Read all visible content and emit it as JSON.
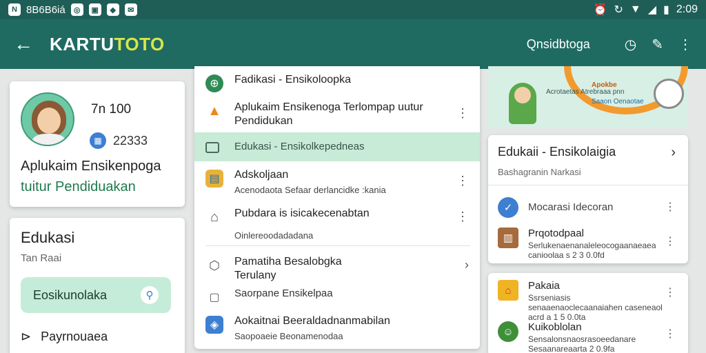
{
  "status": {
    "time": "2:09",
    "left_text": "8B6B6iá"
  },
  "appbar": {
    "title_a": "KARTU",
    "title_b": "TOTO",
    "subtitle": "Qnsidbtoga"
  },
  "profile": {
    "stat1": "7n 100",
    "stat2": "22333",
    "name_line1": "Aplukaim Ensikenpoga",
    "name_line2": "tuitur Pendiduakan"
  },
  "left_card": {
    "heading": "Edukasi",
    "subtext": "Tan Raai",
    "button_label": "Eosikunolaka",
    "pay_label": "Payrnouaea"
  },
  "middle_list": [
    {
      "title": "Fadikasi - Ensikoloopka",
      "desc": "",
      "icon": "green-circle-icon",
      "more": false
    },
    {
      "title": "Aplukaim Ensikenoga Terlompap uutur Pendidukan",
      "desc": "",
      "icon": "triangle-logo-icon",
      "more": true
    },
    {
      "title": "Edukasi - Ensikolkepedneas",
      "desc": "",
      "icon": "folder-icon",
      "more": false,
      "selected": true
    },
    {
      "title": "Adskoljaan",
      "desc": "Acenodaota Sefaar derlancidke :kania",
      "icon": "store-icon",
      "more": true
    },
    {
      "title": "Pubdara is isicakecenabtan",
      "desc": "Oinlereoodadadana",
      "icon": "chart-house-icon",
      "more": true
    },
    {
      "title": "Pamatiha Besalobgka",
      "desc": "Terulany",
      "icon": "badge-icon",
      "more": true
    },
    {
      "title": "Saorpane Ensikelpaa",
      "desc": "",
      "icon": "square-icon",
      "more": false
    },
    {
      "title": "Aokaitnai Beeraldadnanmabilan",
      "desc": "Saopoaeie Beonamenodaa",
      "icon": "shield-icon",
      "more": false
    }
  ],
  "banner": {
    "text_a": "Acrotaetas\nAtrebraaa pnn",
    "text_b": "Apokbe",
    "text_c": "Saaon Oenaotae"
  },
  "right_card1": {
    "heading": "Edukaii - Ensikolaigia",
    "subtext": "Bashagranin Narkasi",
    "items": [
      {
        "title": "Mocarasi Idecoran",
        "desc": "",
        "icon": "map-pin-icon"
      },
      {
        "title": "Prqotodpaal",
        "desc": "Serlukenaenanaleleocogaanaeaea\ncanioolaa s 2 3 0.0fd",
        "icon": "basket-icon"
      }
    ]
  },
  "right_card2": {
    "items": [
      {
        "title": "Pakaia",
        "desc": "Ssrseniasis senaaenaoclecaanaiahen\ncaseneaol acrd a 1 5 0.0ta",
        "icon": "house-icon"
      },
      {
        "title": "Kuikoblolan",
        "desc": "Sensalonsnaosrasoeedanare\nSesaanareaarta 2 0.9fa",
        "icon": "mascot-icon"
      }
    ]
  },
  "colors": {
    "primary": "#1f6b62",
    "accent_green": "#c5ecd8",
    "highlight": "#d8e64a"
  }
}
